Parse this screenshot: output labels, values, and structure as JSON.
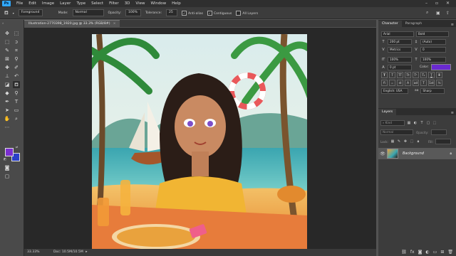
{
  "menubar": {
    "logo": "Ps",
    "items": [
      "File",
      "Edit",
      "Image",
      "Layer",
      "Type",
      "Select",
      "Filter",
      "3D",
      "View",
      "Window",
      "Help"
    ]
  },
  "options_bar": {
    "source_value": "Foreground",
    "mode_label": "Mode:",
    "mode_value": "Normal",
    "opacity_label": "Opacity:",
    "opacity_value": "100%",
    "tolerance_label": "Tolerance:",
    "tolerance_value": "25",
    "anti_alias_label": "Anti-alias",
    "contiguous_label": "Contiguous",
    "all_layers_label": "All Layers"
  },
  "document": {
    "tab_title": "Illustration-2770398_1920.jpg @ 33.3% (RGB/8#)",
    "close_glyph": "×",
    "zoom_status": "33.33%",
    "doc_status": "Doc: 10.5M/10.5M"
  },
  "colors": {
    "foreground": "#7b2fd0",
    "background": "#2a40c8",
    "text_color": "#6a2ad0"
  },
  "character_panel": {
    "tab_character": "Character",
    "tab_paragraph": "Paragraph",
    "font_family": "Arial",
    "font_style": "Bold",
    "font_size": "200 pt",
    "leading": "(Auto)",
    "kerning": "Metrics",
    "tracking": "0",
    "baseline": "0 pt",
    "vertical_scale": "100%",
    "horizontal_scale": "100%",
    "color_label": "Color:",
    "type_buttons": [
      "T",
      "T",
      "TT",
      "Tt",
      "T¹",
      "T₁",
      "T",
      "T"
    ],
    "feature_buttons": [
      "fi",
      "ℴ",
      "st",
      "A",
      "ad",
      "T",
      "1st",
      "½"
    ],
    "language": "English: USA",
    "aa_symbol": "aa",
    "antialias": "Sharp"
  },
  "layers_panel": {
    "title": "Layers",
    "kind_label": "Kind",
    "blend_mode": "Normal",
    "opacity_label": "Opacity:",
    "lock_label": "Lock:",
    "fill_label": "Fill:",
    "layer_name": "Background"
  }
}
